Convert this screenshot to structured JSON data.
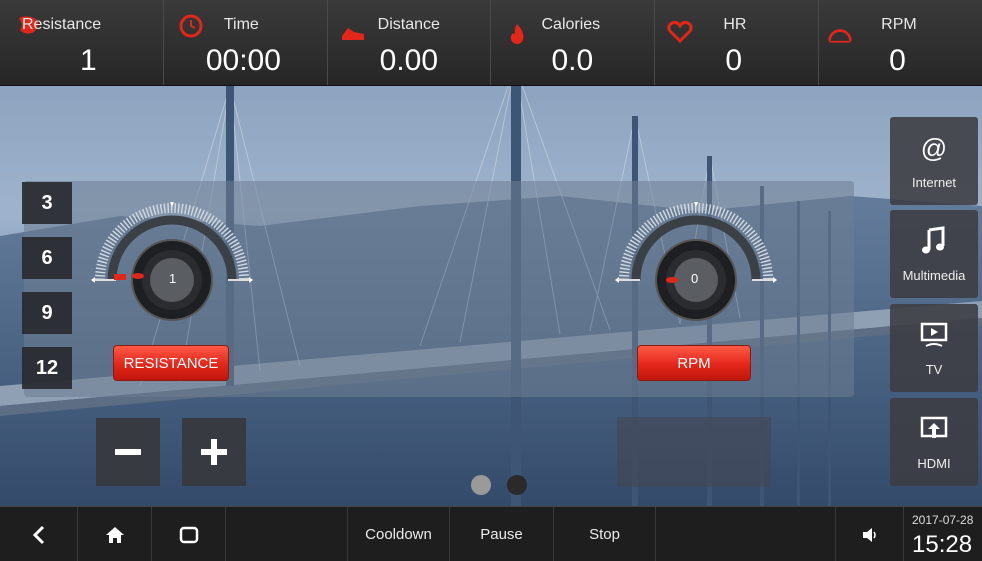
{
  "stats": [
    {
      "label": "Resistance",
      "value": "1",
      "icon": "resistance-icon"
    },
    {
      "label": "Time",
      "value": "00:00",
      "icon": "clock-icon"
    },
    {
      "label": "Distance",
      "value": "0.00",
      "icon": "shoe-icon"
    },
    {
      "label": "Calories",
      "value": "0.0",
      "icon": "flame-icon"
    },
    {
      "label": "HR",
      "value": "0",
      "icon": "heart-icon"
    },
    {
      "label": "RPM",
      "value": "0",
      "icon": "speedometer-icon"
    }
  ],
  "levels": [
    "3",
    "6",
    "9",
    "12"
  ],
  "resistance_gauge": {
    "value": "1",
    "button_label": "RESISTANCE"
  },
  "rpm_gauge": {
    "value": "0",
    "button_label": "RPM"
  },
  "side_buttons": [
    {
      "label": "Internet",
      "icon": "at-icon"
    },
    {
      "label": "Multimedia",
      "icon": "music-note-icon"
    },
    {
      "label": "TV",
      "icon": "tv-icon"
    },
    {
      "label": "HDMI",
      "icon": "hdmi-icon"
    }
  ],
  "nav": {
    "cooldown": "Cooldown",
    "pause": "Pause",
    "stop": "Stop",
    "date": "2017-07-28",
    "time": "15:28"
  },
  "colors": {
    "accent_red": "#e3261a",
    "bar_bg": "#262626"
  }
}
